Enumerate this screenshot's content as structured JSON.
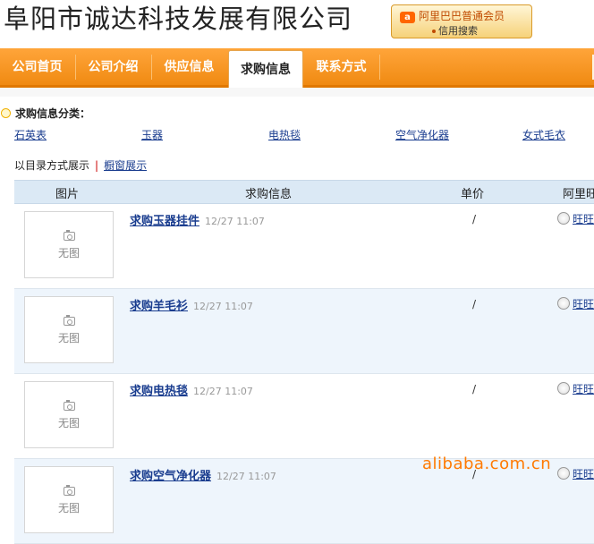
{
  "header": {
    "company_name": "阜阳市诚达科技发展有限公司",
    "badge_logo": "a",
    "badge_line1": "阿里巴巴普通会员",
    "badge_line2": "信用搜索"
  },
  "nav": {
    "tabs": [
      {
        "label": "公司首页",
        "active": false
      },
      {
        "label": "公司介绍",
        "active": false
      },
      {
        "label": "供应信息",
        "active": false
      },
      {
        "label": "求购信息",
        "active": true
      },
      {
        "label": "联系方式",
        "active": false
      }
    ]
  },
  "categories": {
    "heading": "求购信息分类：",
    "items": [
      "石英表",
      "玉器",
      "电热毯",
      "空气净化器",
      "女式毛衣"
    ]
  },
  "display_mode": {
    "label": "以目录方式展示",
    "separator": "|",
    "alt_link": "橱窗展示"
  },
  "table": {
    "columns": [
      "图片",
      "求购信息",
      "单价",
      "阿里旺旺"
    ],
    "rows": [
      {
        "image_text": "无图",
        "name": "求购玉器挂件",
        "date": "12/27 11:07",
        "price": "/",
        "ww": "旺旺"
      },
      {
        "image_text": "无图",
        "name": "求购羊毛衫",
        "date": "12/27 11:07",
        "price": "/",
        "ww": "旺旺"
      },
      {
        "image_text": "无图",
        "name": "求购电热毯",
        "date": "12/27 11:07",
        "price": "/",
        "ww": "旺旺"
      },
      {
        "image_text": "无图",
        "name": "求购空气净化器",
        "date": "12/27 11:07",
        "price": "/",
        "ww": "旺旺"
      }
    ]
  },
  "watermark": "alibaba.com.cn",
  "colors": {
    "nav_orange": "#f08a12",
    "link_blue": "#1a3d8f",
    "header_blue": "#dbe9f5"
  }
}
